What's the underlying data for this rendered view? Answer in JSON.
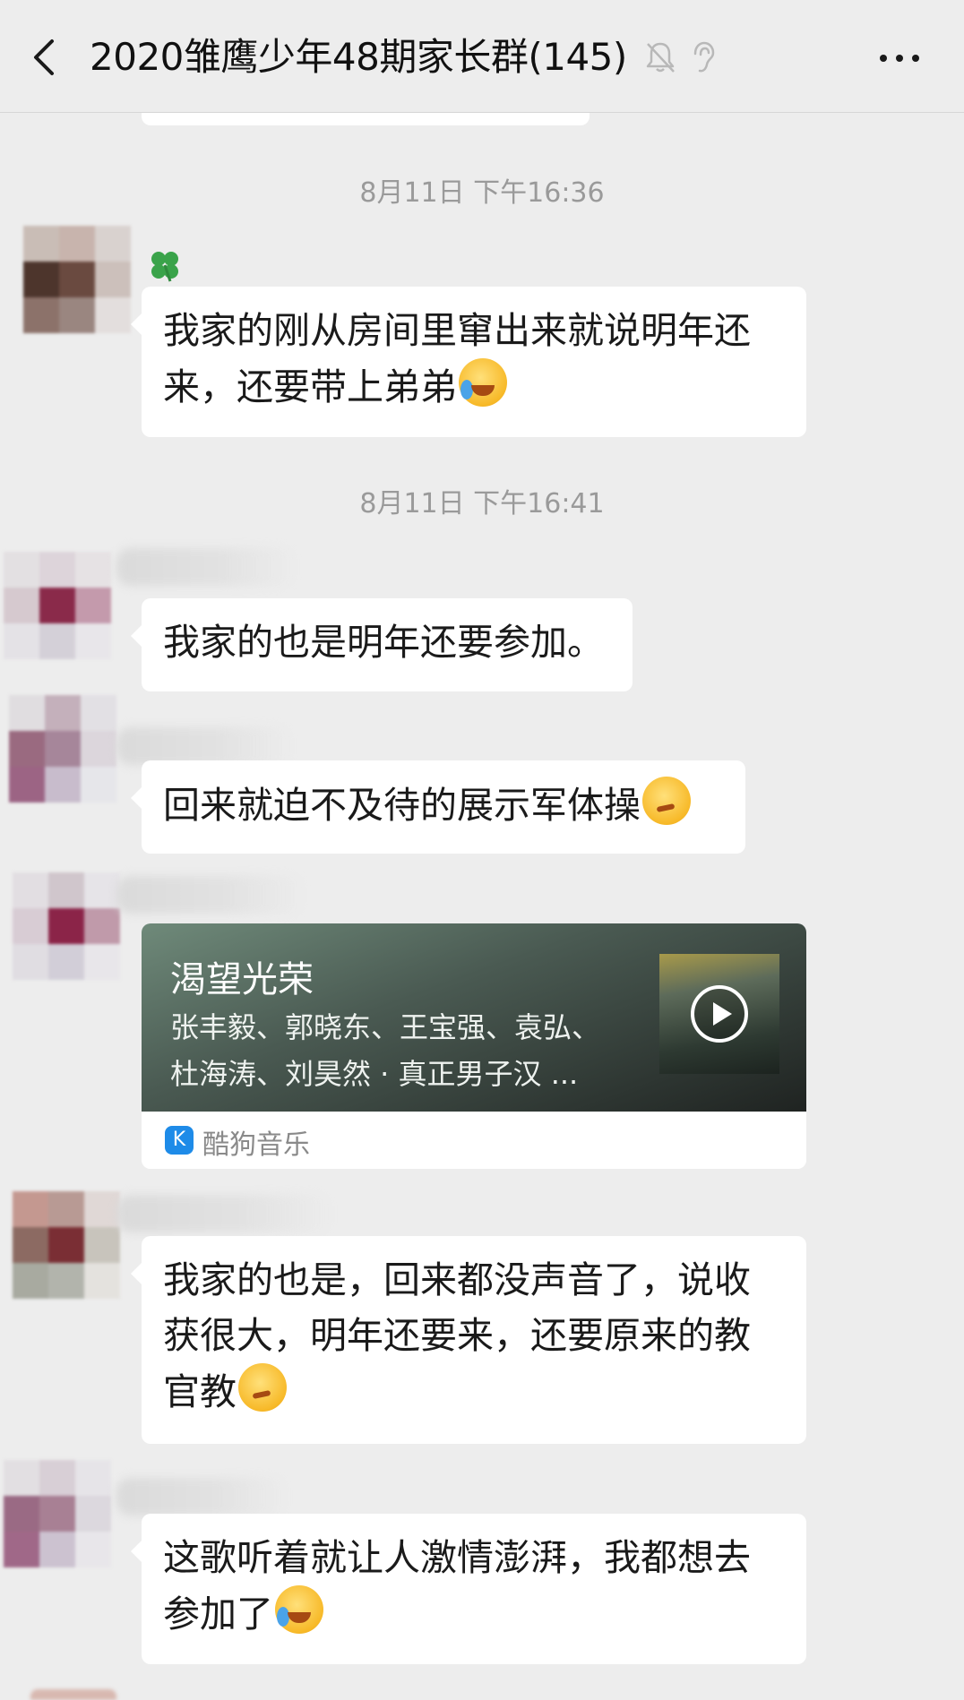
{
  "header": {
    "title": "2020雏鹰少年48期家长群(145)"
  },
  "icons": {
    "back": "chevron-left-icon",
    "mute": "bell-mute-icon",
    "ear": "ear-icon",
    "more": "more-dots-icon"
  },
  "messages": {
    "ts1": "8月11日 下午16:36",
    "m1_line1": "我家的刚从房间里窜出来就说明年还",
    "m1_line2": "来，还要带上弟弟",
    "ts2": "8月11日 下午16:41",
    "m2": "我家的也是明年还要参加。",
    "m3": "回来就迫不及待的展示军体操",
    "m5_line1": "我家的也是，回来都没声音了，说收",
    "m5_line2": "获很大，明年还要来，还要原来的教",
    "m5_line3": "官教",
    "m6_line1": "这歌听着就让人激情澎湃，我都想去",
    "m6_line2": "参加了"
  },
  "music_card": {
    "title": "渴望光荣",
    "artists_line1": "张丰毅、郭晓东、王宝强、袁弘、",
    "artists_line2": "杜海涛、刘昊然 · 真正男子汉 ...",
    "source": "酷狗音乐",
    "source_icon_letter": "K"
  },
  "colors": {
    "background": "#ededed",
    "bubble": "#ffffff",
    "timestamp": "#9a9a9a",
    "kugou_blue": "#1e8be8"
  }
}
